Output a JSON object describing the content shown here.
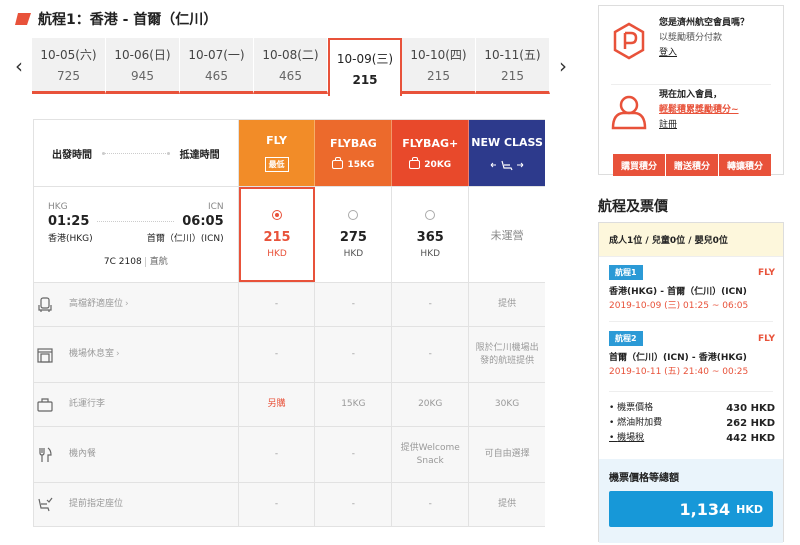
{
  "flight": {
    "title": "航程1：香港 - 首爾（仁川）"
  },
  "dates": [
    {
      "date": "10-05(六)",
      "price": "725",
      "active": false
    },
    {
      "date": "10-06(日)",
      "price": "945",
      "active": false
    },
    {
      "date": "10-07(一)",
      "price": "465",
      "active": false
    },
    {
      "date": "10-08(二)",
      "price": "465",
      "active": false
    },
    {
      "date": "10-09(三)",
      "price": "215",
      "active": true
    },
    {
      "date": "10-10(四)",
      "price": "215",
      "active": false
    },
    {
      "date": "10-11(五)",
      "price": "215",
      "active": false
    }
  ],
  "table": {
    "depart_label": "出發時間",
    "arrive_label": "抵達時間",
    "fares": [
      {
        "name": "FLY",
        "sub": "最低",
        "color": "#f28c28"
      },
      {
        "name": "FLYBAG",
        "sub": "15KG",
        "color": "#ec6a2c"
      },
      {
        "name": "FLYBAG+",
        "sub": "20KG",
        "color": "#e8492b"
      },
      {
        "name": "NEW CLASS",
        "sub": "←💺→",
        "color": "#2d3a8c"
      }
    ],
    "flight_row": {
      "from_code": "HKG",
      "to_code": "ICN",
      "dep_time": "01:25",
      "arr_time": "06:05",
      "from_city": "香港(HKG)",
      "to_city": "首爾（仁川）(ICN)",
      "flight_no": "7C 2108",
      "type": "直航",
      "prices": [
        {
          "amount": "215",
          "currency": "HKD",
          "selected": true
        },
        {
          "amount": "275",
          "currency": "HKD",
          "selected": false
        },
        {
          "amount": "365",
          "currency": "HKD",
          "selected": false
        }
      ],
      "na_text": "未運營"
    },
    "features": [
      {
        "label": "高檔舒適座位",
        "chev": "›",
        "icon": "seat-icon",
        "values": [
          "-",
          "-",
          "-",
          "提供"
        ]
      },
      {
        "label": "機場休息室",
        "chev": "›",
        "icon": "lounge-icon",
        "values": [
          "-",
          "-",
          "-",
          "限於仁川機場出發的航班提供"
        ]
      },
      {
        "label": "託運行李",
        "chev": "",
        "icon": "luggage-icon",
        "values": [
          "另購",
          "15KG",
          "20KG",
          "30KG"
        ]
      },
      {
        "label": "機內餐",
        "chev": "",
        "icon": "meal-icon",
        "values": [
          "-",
          "-",
          "提供Welcome Snack",
          "可自由選擇"
        ]
      },
      {
        "label": "提前指定座位",
        "chev": "",
        "icon": "seat-select-icon",
        "values": [
          "-",
          "-",
          "-",
          "提供"
        ]
      }
    ]
  },
  "member": {
    "q": "您是濟州航空會員嗎？",
    "q_sub": "以獎勵積分付款",
    "login": "登入",
    "join": "現在加入會員，",
    "join_sub": "輕鬆積累獎勵積分~",
    "register": "註冊",
    "buttons": [
      "購買積分",
      "贈送積分",
      "轉讓積分"
    ]
  },
  "summary": {
    "title": "航程及票價",
    "pax": "成人1位 / 兒童0位 / 嬰兒0位",
    "segments": [
      {
        "tag": "航程1",
        "fare": "FLY",
        "route": "香港(HKG) - 首爾（仁川）(ICN)",
        "time": "2019-10-09 (三) 01:25 ~ 06:05"
      },
      {
        "tag": "航程2",
        "fare": "FLY",
        "route": "首爾（仁川）(ICN) - 香港(HKG)",
        "time": "2019-10-11 (五) 21:40 ~ 00:25"
      }
    ],
    "costs": [
      {
        "label": "機票價格",
        "value": "430 HKD",
        "u": false
      },
      {
        "label": "燃油附加費",
        "value": "262 HKD",
        "u": false
      },
      {
        "label": "機場稅",
        "value": "442 HKD",
        "u": true
      }
    ],
    "total_label": "機票價格等總額",
    "total_value": "1,134",
    "total_currency": "HKD"
  },
  "colors": {
    "accent": "#e8523a",
    "blue": "#1798d8"
  }
}
